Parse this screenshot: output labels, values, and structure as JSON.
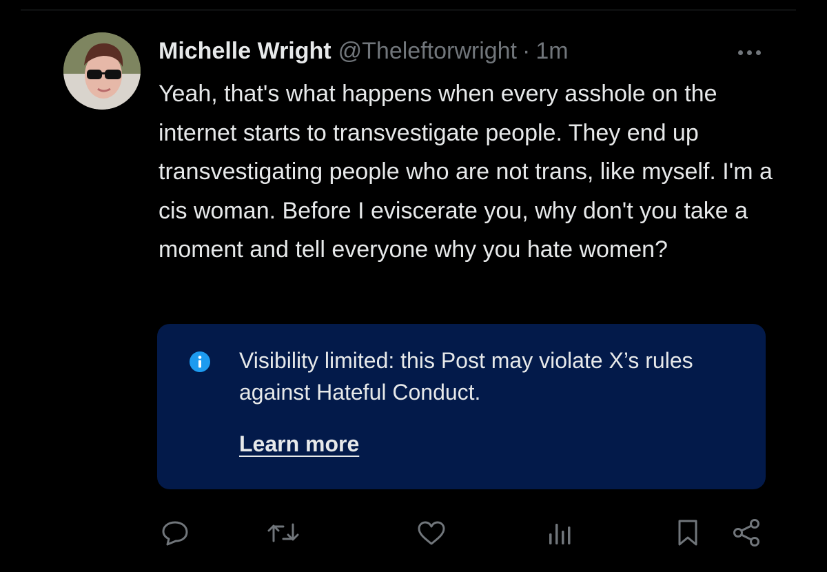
{
  "post": {
    "author_name": "Michelle Wright",
    "author_handle": "@Theleftorwright",
    "separator": "·",
    "timestamp": "1m",
    "text": "Yeah, that's what happens when every asshole on the internet starts to transvestigate people. They end up transvestigating people who are not trans, like myself. I'm a cis woman. Before I eviscerate you, why don't you take a moment and tell everyone why you hate women?"
  },
  "notice": {
    "message": "Visibility limited: this Post may violate X’s rules against Hateful Conduct.",
    "link_label": "Learn more"
  },
  "actions": [
    "reply-icon",
    "repost-icon",
    "like-icon",
    "views-icon",
    "bookmark-icon",
    "share-icon"
  ],
  "colors": {
    "background": "#000000",
    "text_primary": "#e7e9ea",
    "text_secondary": "#71767b",
    "notice_background": "#031a4a",
    "info_blue": "#1d9bf0"
  }
}
